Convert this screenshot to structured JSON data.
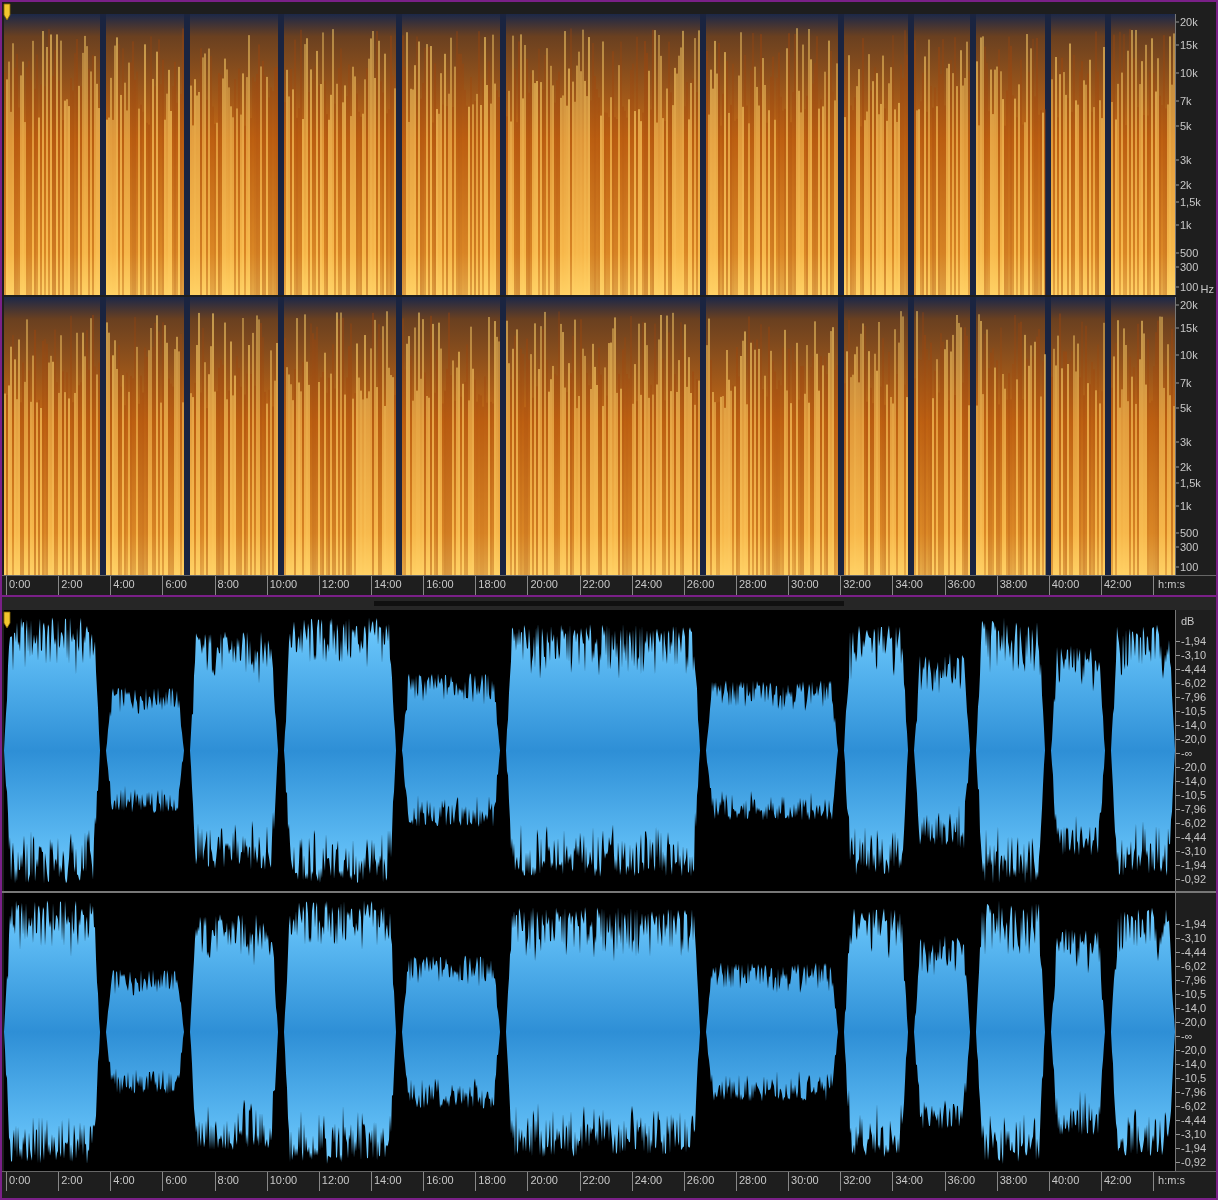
{
  "spectrogram": {
    "channels": [
      {
        "frequency_labels": [
          "20k",
          "15k",
          "10k",
          "7k",
          "5k",
          "3k",
          "2k",
          "1,5k",
          "1k",
          "500",
          "300",
          "100"
        ],
        "unit": "Hz"
      },
      {
        "frequency_labels": [
          "20k",
          "15k",
          "10k",
          "7k",
          "5k",
          "3k",
          "2k",
          "1,5k",
          "1k",
          "500",
          "300",
          "100"
        ]
      }
    ],
    "time_labels": [
      "0:00",
      "2:00",
      "4:00",
      "6:00",
      "8:00",
      "10:00",
      "12:00",
      "14:00",
      "16:00",
      "18:00",
      "20:00",
      "22:00",
      "24:00",
      "26:00",
      "28:00",
      "30:00",
      "32:00",
      "34:00",
      "36:00",
      "38:00",
      "40:00",
      "42:00"
    ],
    "time_unit": "h:m:s"
  },
  "waveform": {
    "channels": [
      {
        "unit": "dB",
        "db_labels": [
          "-1,94",
          "-3,10",
          "-4,44",
          "-6,02",
          "-7,96",
          "-10,5",
          "-14,0",
          "-20,0",
          "-∞",
          "-20,0",
          "-14,0",
          "-10,5",
          "-7,96",
          "-6,02",
          "-4,44",
          "-3,10",
          "-1,94",
          "-0,92"
        ]
      },
      {
        "db_labels": [
          "-1,94",
          "-3,10",
          "-4,44",
          "-6,02",
          "-7,96",
          "-10,5",
          "-14,0",
          "-20,0",
          "-∞",
          "-20,0",
          "-14,0",
          "-10,5",
          "-7,96",
          "-6,02",
          "-4,44",
          "-3,10",
          "-1,94",
          "-0,92"
        ]
      }
    ],
    "time_labels": [
      "0:00",
      "2:00",
      "4:00",
      "6:00",
      "8:00",
      "10:00",
      "12:00",
      "14:00",
      "16:00",
      "18:00",
      "20:00",
      "22:00",
      "24:00",
      "26:00",
      "28:00",
      "30:00",
      "32:00",
      "34:00",
      "36:00",
      "38:00",
      "40:00",
      "42:00"
    ],
    "time_unit": "h:m:s"
  }
}
